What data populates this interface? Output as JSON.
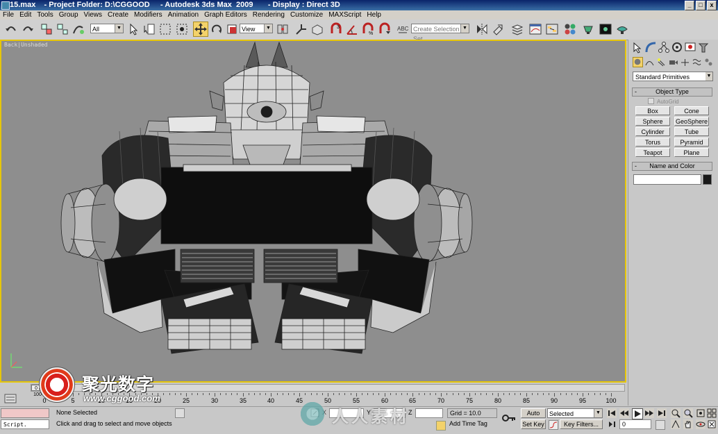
{
  "window": {
    "title": "15.max    - Project Folder: D:\\CGGOOD     - Autodesk 3ds Max  2009       - Display : Direct 3D",
    "controls": [
      "_",
      "□",
      "x"
    ]
  },
  "menu": [
    "File",
    "Edit",
    "Tools",
    "Group",
    "Views",
    "Create",
    "Modifiers",
    "Animation",
    "Graph Editors",
    "Rendering",
    "Customize",
    "MAXScript",
    "Help"
  ],
  "toolbar": {
    "selection_filter": "All",
    "reference_coord": "View",
    "named_selection_placeholder": "Create Selection Set",
    "icons": [
      "undo-icon",
      "redo-icon",
      "select-link-icon",
      "unlink-icon",
      "bind-spacewarp-icon",
      "select-object-icon",
      "select-by-name-icon",
      "rect-region-icon",
      "window-crossing-icon",
      "select-move-icon",
      "select-rotate-icon",
      "select-scale-icon",
      "pivot-center-icon",
      "select-manipulate-icon",
      "keyboard-shortcut-icon",
      "snap-3d-icon",
      "angle-snap-icon",
      "percent-snap-icon",
      "spinner-snap-icon",
      "edit-named-sets-icon",
      "mirror-icon",
      "align-icon",
      "layer-manager-icon",
      "curve-editor-icon",
      "schematic-view-icon",
      "material-editor-icon",
      "render-setup-icon",
      "rendered-frame-icon",
      "quick-render-icon"
    ]
  },
  "viewport": {
    "label": "Back|Unshaded",
    "border_color": "#e6c60a",
    "background_color": "#8e8e8e"
  },
  "command_panel": {
    "tab_icons": [
      "create-tab-icon",
      "modify-tab-icon",
      "hierarchy-tab-icon",
      "motion-tab-icon",
      "display-tab-icon",
      "utilities-tab-icon"
    ],
    "subtab_icons": [
      "geometry-icon",
      "shapes-icon",
      "lights-icon",
      "cameras-icon",
      "helpers-icon",
      "spacewarps-icon",
      "systems-icon"
    ],
    "category": "Standard Primitives",
    "object_type_header": "Object Type",
    "autogrid_label": "AutoGrid",
    "object_buttons": [
      "Box",
      "Cone",
      "Sphere",
      "GeoSphere",
      "Cylinder",
      "Tube",
      "Torus",
      "Pyramid",
      "Teapot",
      "Plane"
    ],
    "name_color_header": "Name and Color",
    "name_value": "",
    "object_color": "#1a1a1a"
  },
  "timeline": {
    "slider_text": "0 / 100",
    "ruler_labels": [
      "0",
      "5",
      "10",
      "15",
      "20",
      "25",
      "30",
      "35",
      "40",
      "45",
      "50",
      "55",
      "60",
      "65",
      "70",
      "75",
      "80",
      "85",
      "90",
      "95",
      "100"
    ]
  },
  "status": {
    "script_label": "Script.",
    "selection_status": "None Selected",
    "prompt": "Click and drag to select and move objects",
    "x_label": "X",
    "x_value": "",
    "y_label": "Y",
    "y_value": "",
    "z_label": "Z",
    "z_value": "",
    "grid": "Grid = 10.0",
    "add_time_tag": "Add Time Tag",
    "auto_key": "Auto Key",
    "set_key": "Set Key",
    "key_mode": "Selected",
    "key_filters": "Key Filters...",
    "current_frame": "0"
  },
  "watermarks": {
    "brand_cn": "聚光数字",
    "brand_url": "www.cggood.com",
    "secondary_cn": "人人素材"
  }
}
